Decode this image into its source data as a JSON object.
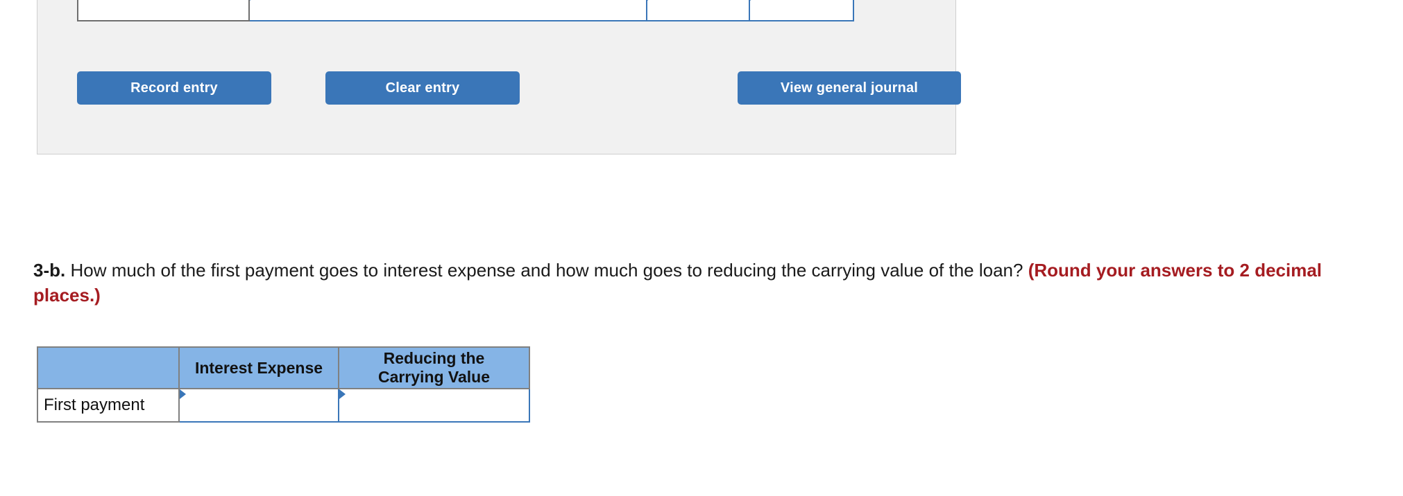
{
  "journal_panel": {
    "name": "journal-entry-panel",
    "table": {
      "columns": [
        "date",
        "general-journal-account",
        "debit",
        "credit"
      ],
      "rows": [
        {
          "date": "",
          "account": "",
          "debit": "",
          "credit": "",
          "active": false
        },
        {
          "date": "",
          "account": "",
          "debit": "",
          "credit": "",
          "active": true
        }
      ]
    },
    "buttons": {
      "record": "Record entry",
      "clear": "Clear entry",
      "view": "View general journal"
    }
  },
  "question": {
    "number": "3-b.",
    "text": " How much of the first payment goes to interest expense and how much goes to reducing the carrying value of the loan? ",
    "note": "(Round your answers to 2 decimal places.)"
  },
  "answer_table": {
    "headers": [
      "",
      "Interest Expense",
      "Reducing the\nCarrying Value"
    ],
    "header_interest": "Interest Expense",
    "header_reducing_line1": "Reducing the",
    "header_reducing_line2": "Carrying Value",
    "rows": [
      {
        "label": "First payment",
        "interest_expense": "",
        "reducing_carrying_value": ""
      }
    ]
  },
  "colors": {
    "panel_bg": "#f1f1f1",
    "button_blue": "#3a76b8",
    "header_blue": "#85b4e6",
    "cell_border_gray": "#808080",
    "input_border_blue": "#3a76b8",
    "warning_red": "#a51c21"
  }
}
